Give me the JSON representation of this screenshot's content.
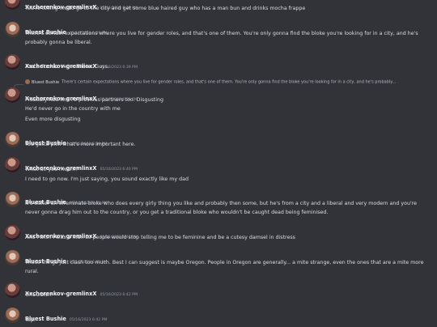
{
  "messages": [
    {
      "author": "Xxcherenkov-gremlinxX",
      "time": "05/16/2023 6:39 PM",
      "avatar": "x",
      "lines": [
        "You're telling me to go to the city and get some blue haired guy who has a man bun and drinks mocha frappe"
      ]
    },
    {
      "author": "Bluest Bushie",
      "time": "05/16/2023 6:39 PM",
      "avatar": "b",
      "lines": [
        "There's certain expectations where you live for gender roles, and that's one of them. You're only gonna find the bloke you're looking for in a city, and he's probably gonna be liberal."
      ]
    },
    {
      "author": "Xxcherenkov-gremlinxX",
      "time": "05/16/2023 6:39 PM",
      "avatar": "x",
      "lines": [
        "And I. Fuckin. Hate. Those. Guys."
      ]
    },
    {
      "author": "Xxcherenkov-gremlinxX",
      "time": "05/16/2023 6:39 PM",
      "avatar": "x",
      "reply": {
        "name": "Bluest Bushie",
        "text": "There's certain expectations where you live for gender roles, and that's one of them. You're only gonna find the bloke you're looking for in a city, and he's probably..."
      },
      "lines": [
        "Probably had like 70 previous partners too. Disgusting",
        "He'd never go in the country with me",
        "Even more disgusting"
      ]
    },
    {
      "author": "Bluest Bushie",
      "time": "05/16/2023 6:40 PM",
      "avatar": "b",
      "lines": [
        "You gotta pick what's more important here."
      ]
    },
    {
      "author": "Xxcherenkov-gremlinxX",
      "time": "05/16/2023 6:40 PM",
      "avatar": "x",
      "lines": [
        "What do you mean!?",
        "I need to go now. I'm just saying, you sound exactly like my dad"
      ]
    },
    {
      "author": "Bluest Bushie",
      "time": "05/16/2023 6:41 PM",
      "avatar": "b",
      "lines": [
        "It's either an effeminate bloke who does every girly thing you like and probably then some, but he's from a city and a liberal and very modern and you're never gonna drag him out to the country, or you get a traditional bloke who wouldn't be caught dead being feminised."
      ]
    },
    {
      "author": "Xxcherenkov-gremlinxX",
      "time": "05/16/2023 6:41 PM",
      "avatar": "x",
      "lines": [
        "And I wish I was a man so people would stop telling me to be feminine and be a cutesy damsel in distress"
      ]
    },
    {
      "author": "Bluest Bushie",
      "time": "05/16/2023 6:42 PM",
      "avatar": "b",
      "lines": [
        "Those things just clash too much. Best I can suggest is maybe Oregon. People in Oregon are generally... a mite strange, even the ones that are a mite more rural."
      ]
    },
    {
      "author": "Xxcherenkov-gremlinxX",
      "time": "05/16/2023 6:42 PM",
      "avatar": "x",
      "lines": [
        "OREGON!?"
      ]
    },
    {
      "author": "Bluest Bushie",
      "time": "05/16/2023 6:42 PM",
      "avatar": "b",
      "lines": [
        "Yep."
      ]
    }
  ]
}
